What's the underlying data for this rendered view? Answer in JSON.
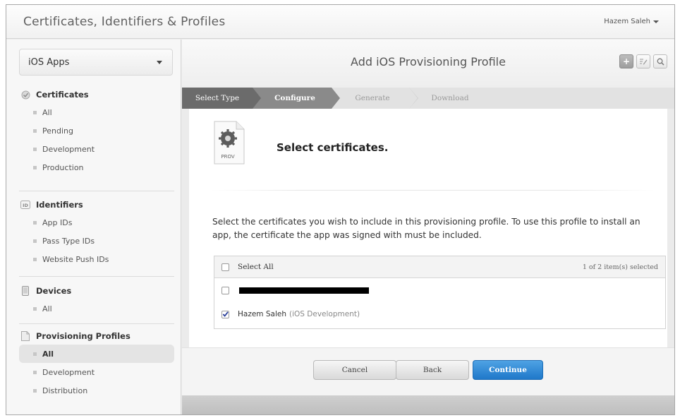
{
  "header": {
    "app_title": "Certificates, Identifiers & Profiles",
    "user_name": "Hazem Saleh"
  },
  "sidebar": {
    "platform": "iOS Apps",
    "sections": [
      {
        "title": "Certificates",
        "icon": "certificate-icon",
        "items": [
          "All",
          "Pending",
          "Development",
          "Production"
        ]
      },
      {
        "title": "Identifiers",
        "icon": "id-badge-icon",
        "items": [
          "App IDs",
          "Pass Type IDs",
          "Website Push IDs"
        ]
      },
      {
        "title": "Devices",
        "icon": "device-icon",
        "items": [
          "All"
        ]
      },
      {
        "title": "Provisioning Profiles",
        "icon": "document-icon",
        "items": [
          "All",
          "Development",
          "Distribution"
        ]
      }
    ],
    "active_item": "Provisioning Profiles / All"
  },
  "main": {
    "title": "Add iOS Provisioning Profile",
    "tool_icons": [
      "plus-icon",
      "edit-icon",
      "search-icon"
    ],
    "steps": [
      {
        "label": "Select Type",
        "state": "done"
      },
      {
        "label": "Configure",
        "state": "current"
      },
      {
        "label": "Generate",
        "state": "todo"
      },
      {
        "label": "Download",
        "state": "todo"
      }
    ],
    "icon_label": "PROV",
    "heading": "Select certificates.",
    "description": "Select the certificates you wish to include in this provisioning profile. To use this profile to install an app, the certificate the app was signed with must be included.",
    "table": {
      "select_all_label": "Select All",
      "selection_count": "1 of 2 item(s) selected",
      "rows": [
        {
          "name": "",
          "type": "",
          "checked": false,
          "redacted": true
        },
        {
          "name": "Hazem Saleh",
          "type": "(iOS Development)",
          "checked": true,
          "redacted": false
        }
      ]
    },
    "buttons": {
      "cancel": "Cancel",
      "back": "Back",
      "continue": "Continue"
    }
  },
  "colors": {
    "primary_button": "#1f78c9",
    "step_done": "#6b6b6b",
    "step_current": "#8a8a8a"
  }
}
